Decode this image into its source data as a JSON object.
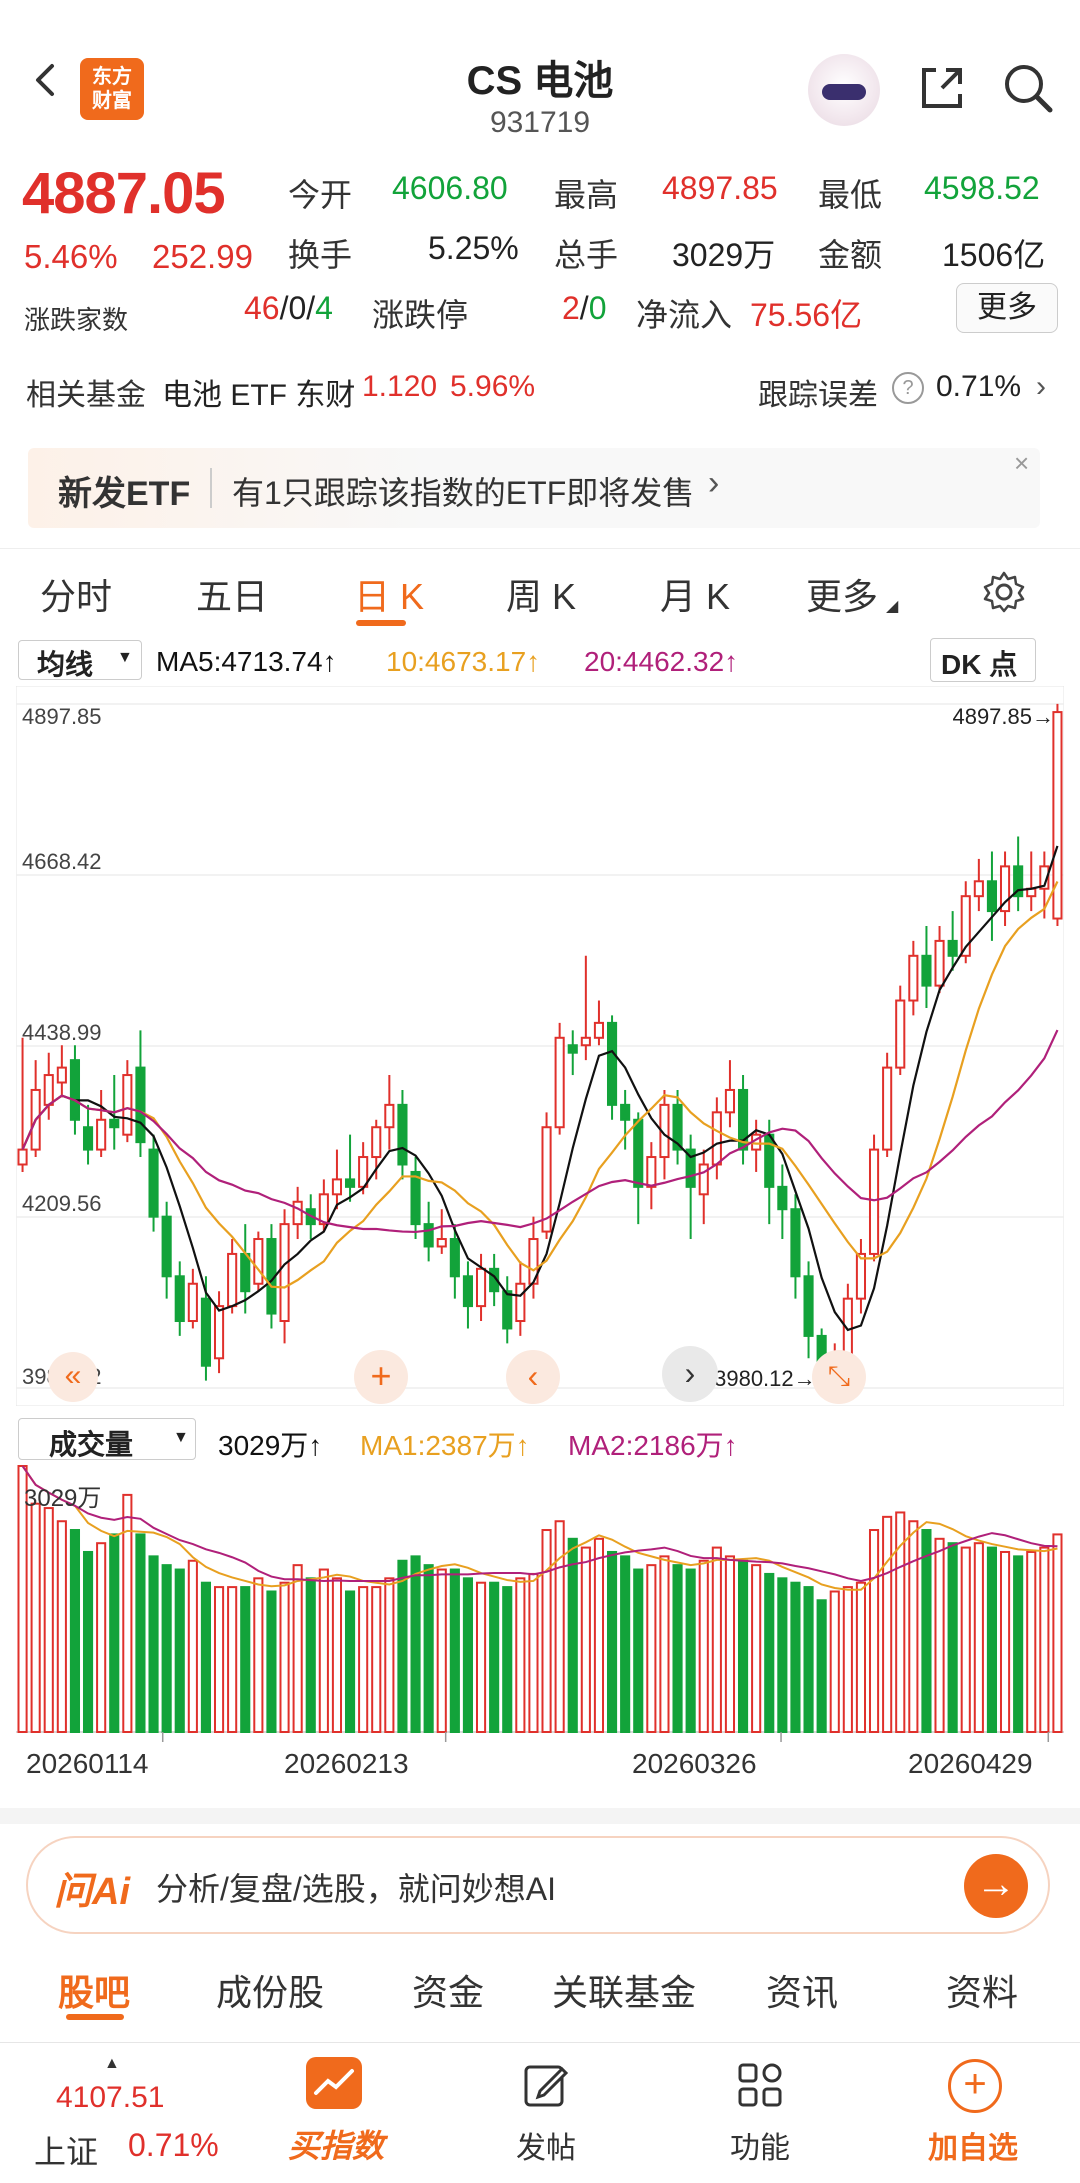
{
  "header": {
    "title": "CS 电池",
    "code": "931719",
    "logo_line1": "东方",
    "logo_line2": "财富"
  },
  "quote": {
    "price": "4887.05",
    "change_pct": "5.46%",
    "change_abs": "252.99",
    "open_label": "今开",
    "open": "4606.80",
    "high_label": "最高",
    "high": "4897.85",
    "low_label": "最低",
    "low": "4598.52",
    "turnover_label": "换手",
    "turnover": "5.25%",
    "volume_label": "总手",
    "volume": "3029万",
    "amount_label": "金额",
    "amount": "1506亿",
    "breadth_label": "涨跌家数",
    "breadth_up": "46",
    "breadth_flat": "0",
    "breadth_down": "4",
    "sep": "/",
    "limit_label": "涨跌停",
    "limit_up": "2",
    "limit_down": "0",
    "netflow_label": "净流入",
    "netflow": "75.56亿",
    "more": "更多"
  },
  "fund": {
    "label": "相关基金",
    "name": "电池 ETF 东财",
    "price": "1.120",
    "pct": "5.96%",
    "track_label": "跟踪误差",
    "track_value": "0.71%"
  },
  "etf_banner": {
    "tag": "新发ETF",
    "text": "有1只跟踪该指数的ETF即将发售"
  },
  "tabs": [
    "分时",
    "五日",
    "日 K",
    "周 K",
    "月 K",
    "更多"
  ],
  "ma_bar": {
    "selector": "均线",
    "ma5": "MA5:4713.74↑",
    "ma10": "10:4673.17↑",
    "ma20": "20:4462.32↑",
    "dk": "DK 点"
  },
  "vol_bar": {
    "selector": "成交量",
    "vol": "3029万↑",
    "ma1": "MA1:2387万↑",
    "ma2": "MA2:2186万↑",
    "top": "3029万"
  },
  "colors": {
    "up": "#e0302b",
    "down": "#12a33a",
    "ma5": "#111111",
    "ma10": "#e8a020",
    "ma20": "#b0207a",
    "brand": "#f06a1c"
  },
  "chart_data": {
    "type": "candlestick",
    "y_ticks": [
      "4897.85",
      "4668.42",
      "4438.99",
      "4209.56",
      "3980.12"
    ],
    "ylim": [
      3980.12,
      4897.85
    ],
    "high_mark": "4897.85",
    "low_mark": "3980.12",
    "x_ticks": [
      "20260114",
      "20260213",
      "20260326",
      "20260429"
    ],
    "candles": [
      [
        4280,
        4300,
        4450,
        4270
      ],
      [
        4300,
        4380,
        4420,
        4290
      ],
      [
        4360,
        4400,
        4430,
        4340
      ],
      [
        4390,
        4410,
        4440,
        4370
      ],
      [
        4420,
        4340,
        4440,
        4320
      ],
      [
        4330,
        4300,
        4360,
        4280
      ],
      [
        4300,
        4340,
        4380,
        4290
      ],
      [
        4340,
        4330,
        4400,
        4300
      ],
      [
        4320,
        4400,
        4420,
        4310
      ],
      [
        4410,
        4310,
        4460,
        4290
      ],
      [
        4300,
        4210,
        4320,
        4190
      ],
      [
        4210,
        4130,
        4230,
        4100
      ],
      [
        4130,
        4070,
        4150,
        4050
      ],
      [
        4070,
        4120,
        4140,
        4060
      ],
      [
        4100,
        4010,
        4130,
        3990
      ],
      [
        4020,
        4090,
        4110,
        4000
      ],
      [
        4090,
        4160,
        4180,
        4080
      ],
      [
        4160,
        4110,
        4200,
        4080
      ],
      [
        4120,
        4180,
        4190,
        4110
      ],
      [
        4180,
        4080,
        4200,
        4060
      ],
      [
        4070,
        4200,
        4220,
        4040
      ],
      [
        4200,
        4230,
        4250,
        4180
      ],
      [
        4220,
        4200,
        4240,
        4180
      ],
      [
        4200,
        4240,
        4260,
        4190
      ],
      [
        4240,
        4260,
        4300,
        4220
      ],
      [
        4260,
        4250,
        4320,
        4230
      ],
      [
        4250,
        4290,
        4310,
        4240
      ],
      [
        4290,
        4330,
        4340,
        4260
      ],
      [
        4330,
        4360,
        4400,
        4300
      ],
      [
        4360,
        4280,
        4380,
        4260
      ],
      [
        4270,
        4200,
        4290,
        4180
      ],
      [
        4200,
        4170,
        4230,
        4150
      ],
      [
        4170,
        4180,
        4220,
        4160
      ],
      [
        4180,
        4130,
        4200,
        4100
      ],
      [
        4130,
        4090,
        4150,
        4060
      ],
      [
        4090,
        4140,
        4160,
        4070
      ],
      [
        4140,
        4110,
        4160,
        4090
      ],
      [
        4110,
        4060,
        4130,
        4040
      ],
      [
        4070,
        4120,
        4150,
        4050
      ],
      [
        4120,
        4180,
        4210,
        4100
      ],
      [
        4190,
        4330,
        4350,
        4180
      ],
      [
        4330,
        4450,
        4470,
        4320
      ],
      [
        4440,
        4430,
        4460,
        4400
      ],
      [
        4440,
        4450,
        4560,
        4420
      ],
      [
        4450,
        4470,
        4500,
        4440
      ],
      [
        4470,
        4360,
        4480,
        4340
      ],
      [
        4360,
        4340,
        4380,
        4300
      ],
      [
        4340,
        4250,
        4350,
        4200
      ],
      [
        4250,
        4290,
        4310,
        4220
      ],
      [
        4290,
        4360,
        4380,
        4260
      ],
      [
        4360,
        4300,
        4380,
        4280
      ],
      [
        4300,
        4250,
        4320,
        4180
      ],
      [
        4240,
        4280,
        4300,
        4200
      ],
      [
        4280,
        4350,
        4370,
        4260
      ],
      [
        4350,
        4380,
        4420,
        4330
      ],
      [
        4380,
        4300,
        4400,
        4280
      ],
      [
        4300,
        4320,
        4340,
        4270
      ],
      [
        4320,
        4250,
        4340,
        4200
      ],
      [
        4250,
        4220,
        4280,
        4180
      ],
      [
        4220,
        4130,
        4240,
        4100
      ],
      [
        4130,
        4050,
        4150,
        4020
      ],
      [
        4050,
        3990,
        4060,
        3980
      ],
      [
        4000,
        4020,
        4040,
        3985
      ],
      [
        4020,
        4100,
        4120,
        4010
      ],
      [
        4100,
        4160,
        4180,
        4080
      ],
      [
        4160,
        4300,
        4320,
        4150
      ],
      [
        4300,
        4410,
        4430,
        4290
      ],
      [
        4410,
        4500,
        4520,
        4400
      ],
      [
        4500,
        4560,
        4580,
        4480
      ],
      [
        4560,
        4520,
        4600,
        4490
      ],
      [
        4520,
        4580,
        4600,
        4510
      ],
      [
        4580,
        4560,
        4620,
        4540
      ],
      [
        4560,
        4640,
        4660,
        4550
      ],
      [
        4640,
        4660,
        4690,
        4620
      ],
      [
        4660,
        4620,
        4700,
        4580
      ],
      [
        4620,
        4680,
        4700,
        4600
      ],
      [
        4680,
        4640,
        4720,
        4620
      ],
      [
        4640,
        4650,
        4700,
        4620
      ],
      [
        4650,
        4680,
        4700,
        4610
      ],
      [
        4610,
        4887,
        4898,
        4600
      ]
    ],
    "volumes": [
      3029,
      2600,
      2550,
      2400,
      2300,
      2050,
      2150,
      2250,
      2700,
      2250,
      2000,
      1900,
      1850,
      1950,
      1700,
      1650,
      1650,
      1650,
      1750,
      1600,
      1700,
      1900,
      1750,
      1850,
      1750,
      1600,
      1650,
      1650,
      1750,
      1950,
      2000,
      1900,
      1850,
      1850,
      1750,
      1700,
      1700,
      1650,
      1750,
      1800,
      2300,
      2400,
      2200,
      2100,
      2200,
      2050,
      2000,
      1850,
      1900,
      2000,
      1900,
      1850,
      1950,
      2100,
      2000,
      1950,
      1900,
      1800,
      1750,
      1700,
      1650,
      1500,
      1600,
      1650,
      1700,
      2300,
      2450,
      2500,
      2400,
      2300,
      2200,
      2150,
      2100,
      2150,
      2100,
      2050,
      2000,
      2050,
      2100,
      2250
    ]
  },
  "ask_ai": {
    "brand": "问Ai",
    "placeholder": "分析/复盘/选股，就问妙想AI"
  },
  "bottom_tabs": [
    "股吧",
    "成份股",
    "资金",
    "关联基金",
    "资讯",
    "资料"
  ],
  "nav": {
    "index_value": "4107.51",
    "index_name": "上证",
    "index_pct": "0.71%",
    "buy": "买指数",
    "post": "发帖",
    "func": "功能",
    "add": "加自选"
  }
}
